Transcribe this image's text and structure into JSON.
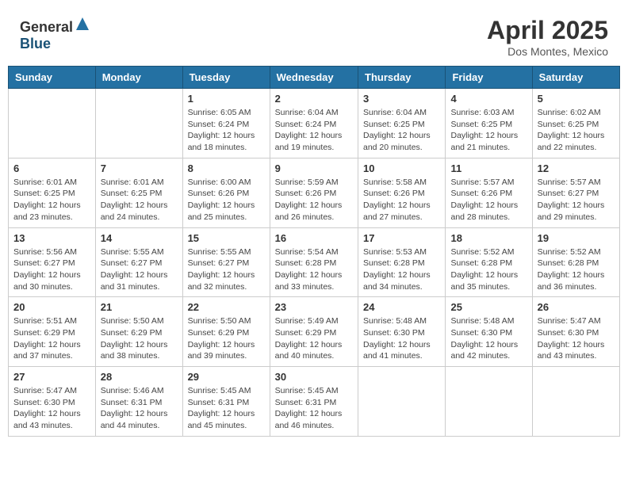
{
  "header": {
    "logo_general": "General",
    "logo_blue": "Blue",
    "month_title": "April 2025",
    "location": "Dos Montes, Mexico"
  },
  "columns": [
    "Sunday",
    "Monday",
    "Tuesday",
    "Wednesday",
    "Thursday",
    "Friday",
    "Saturday"
  ],
  "weeks": [
    [
      {
        "day": "",
        "info": ""
      },
      {
        "day": "",
        "info": ""
      },
      {
        "day": "1",
        "info": "Sunrise: 6:05 AM\nSunset: 6:24 PM\nDaylight: 12 hours and 18 minutes."
      },
      {
        "day": "2",
        "info": "Sunrise: 6:04 AM\nSunset: 6:24 PM\nDaylight: 12 hours and 19 minutes."
      },
      {
        "day": "3",
        "info": "Sunrise: 6:04 AM\nSunset: 6:25 PM\nDaylight: 12 hours and 20 minutes."
      },
      {
        "day": "4",
        "info": "Sunrise: 6:03 AM\nSunset: 6:25 PM\nDaylight: 12 hours and 21 minutes."
      },
      {
        "day": "5",
        "info": "Sunrise: 6:02 AM\nSunset: 6:25 PM\nDaylight: 12 hours and 22 minutes."
      }
    ],
    [
      {
        "day": "6",
        "info": "Sunrise: 6:01 AM\nSunset: 6:25 PM\nDaylight: 12 hours and 23 minutes."
      },
      {
        "day": "7",
        "info": "Sunrise: 6:01 AM\nSunset: 6:25 PM\nDaylight: 12 hours and 24 minutes."
      },
      {
        "day": "8",
        "info": "Sunrise: 6:00 AM\nSunset: 6:26 PM\nDaylight: 12 hours and 25 minutes."
      },
      {
        "day": "9",
        "info": "Sunrise: 5:59 AM\nSunset: 6:26 PM\nDaylight: 12 hours and 26 minutes."
      },
      {
        "day": "10",
        "info": "Sunrise: 5:58 AM\nSunset: 6:26 PM\nDaylight: 12 hours and 27 minutes."
      },
      {
        "day": "11",
        "info": "Sunrise: 5:57 AM\nSunset: 6:26 PM\nDaylight: 12 hours and 28 minutes."
      },
      {
        "day": "12",
        "info": "Sunrise: 5:57 AM\nSunset: 6:27 PM\nDaylight: 12 hours and 29 minutes."
      }
    ],
    [
      {
        "day": "13",
        "info": "Sunrise: 5:56 AM\nSunset: 6:27 PM\nDaylight: 12 hours and 30 minutes."
      },
      {
        "day": "14",
        "info": "Sunrise: 5:55 AM\nSunset: 6:27 PM\nDaylight: 12 hours and 31 minutes."
      },
      {
        "day": "15",
        "info": "Sunrise: 5:55 AM\nSunset: 6:27 PM\nDaylight: 12 hours and 32 minutes."
      },
      {
        "day": "16",
        "info": "Sunrise: 5:54 AM\nSunset: 6:28 PM\nDaylight: 12 hours and 33 minutes."
      },
      {
        "day": "17",
        "info": "Sunrise: 5:53 AM\nSunset: 6:28 PM\nDaylight: 12 hours and 34 minutes."
      },
      {
        "day": "18",
        "info": "Sunrise: 5:52 AM\nSunset: 6:28 PM\nDaylight: 12 hours and 35 minutes."
      },
      {
        "day": "19",
        "info": "Sunrise: 5:52 AM\nSunset: 6:28 PM\nDaylight: 12 hours and 36 minutes."
      }
    ],
    [
      {
        "day": "20",
        "info": "Sunrise: 5:51 AM\nSunset: 6:29 PM\nDaylight: 12 hours and 37 minutes."
      },
      {
        "day": "21",
        "info": "Sunrise: 5:50 AM\nSunset: 6:29 PM\nDaylight: 12 hours and 38 minutes."
      },
      {
        "day": "22",
        "info": "Sunrise: 5:50 AM\nSunset: 6:29 PM\nDaylight: 12 hours and 39 minutes."
      },
      {
        "day": "23",
        "info": "Sunrise: 5:49 AM\nSunset: 6:29 PM\nDaylight: 12 hours and 40 minutes."
      },
      {
        "day": "24",
        "info": "Sunrise: 5:48 AM\nSunset: 6:30 PM\nDaylight: 12 hours and 41 minutes."
      },
      {
        "day": "25",
        "info": "Sunrise: 5:48 AM\nSunset: 6:30 PM\nDaylight: 12 hours and 42 minutes."
      },
      {
        "day": "26",
        "info": "Sunrise: 5:47 AM\nSunset: 6:30 PM\nDaylight: 12 hours and 43 minutes."
      }
    ],
    [
      {
        "day": "27",
        "info": "Sunrise: 5:47 AM\nSunset: 6:30 PM\nDaylight: 12 hours and 43 minutes."
      },
      {
        "day": "28",
        "info": "Sunrise: 5:46 AM\nSunset: 6:31 PM\nDaylight: 12 hours and 44 minutes."
      },
      {
        "day": "29",
        "info": "Sunrise: 5:45 AM\nSunset: 6:31 PM\nDaylight: 12 hours and 45 minutes."
      },
      {
        "day": "30",
        "info": "Sunrise: 5:45 AM\nSunset: 6:31 PM\nDaylight: 12 hours and 46 minutes."
      },
      {
        "day": "",
        "info": ""
      },
      {
        "day": "",
        "info": ""
      },
      {
        "day": "",
        "info": ""
      }
    ]
  ]
}
